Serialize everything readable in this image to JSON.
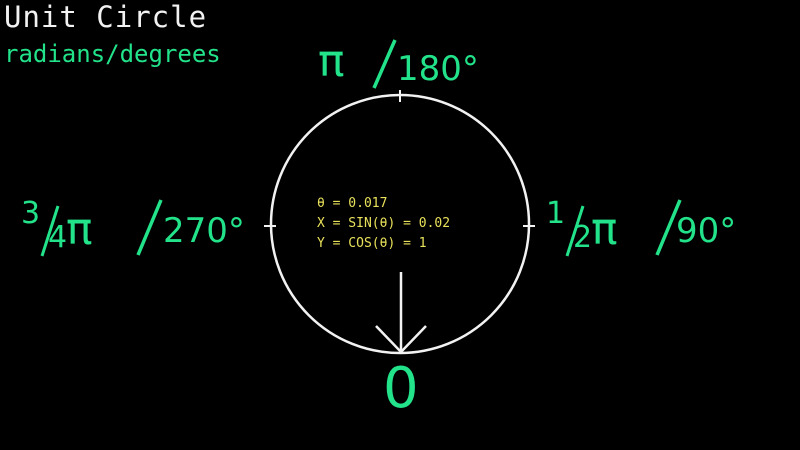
{
  "header": {
    "title": "Unit Circle",
    "subtitle": "radians/degrees"
  },
  "labels": {
    "top": {
      "radian": "π",
      "degrees": "180°"
    },
    "right": {
      "radian_num": "1",
      "radian_den": "2",
      "radian_sym": "π",
      "degrees": "90°"
    },
    "left": {
      "radian_num": "3",
      "radian_den": "4",
      "radian_sym": "π",
      "degrees": "270°"
    },
    "bottom": {
      "radian": "0"
    }
  },
  "readout": {
    "theta": "θ = 0.017",
    "x": "X = SIN(θ) = 0.02",
    "y": "Y = COS(θ) = 1"
  },
  "colors": {
    "accent": "#22e38a",
    "readout": "#e8e05a",
    "circle": "#f2f2f2",
    "background": "#000000"
  }
}
